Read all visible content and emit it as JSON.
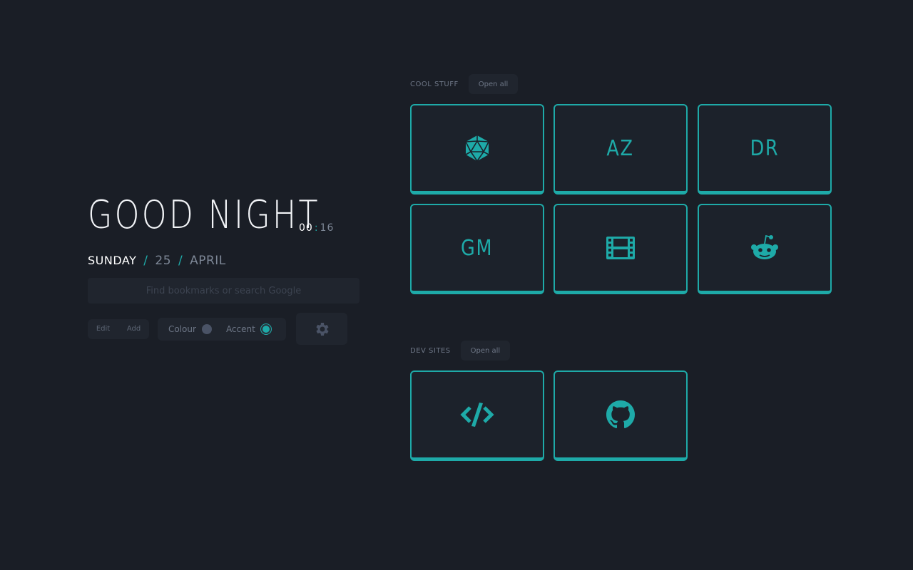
{
  "greeting": {
    "text": "GOOD NIGHT",
    "clock_hours": "00",
    "clock_separator": ":",
    "clock_minutes": "16"
  },
  "date": {
    "day": "SUNDAY",
    "slash1": "/",
    "number": "25",
    "slash2": "/",
    "month": "APRIL"
  },
  "search": {
    "placeholder": "Find bookmarks or search Google"
  },
  "controls": {
    "edit_label": "Edit",
    "add_label": "Add",
    "colour_label": "Colour",
    "accent_label": "Accent"
  },
  "groups": [
    {
      "title": "COOL STUFF",
      "open_all": "Open all",
      "cards": [
        {
          "icon": "d20-dice-icon"
        },
        {
          "label": "AZ"
        },
        {
          "label": "DR"
        },
        {
          "label": "GM"
        },
        {
          "icon": "film-icon"
        },
        {
          "icon": "reddit-icon"
        }
      ]
    },
    {
      "title": "DEV SITES",
      "open_all": "Open all",
      "cards": [
        {
          "icon": "code-icon"
        },
        {
          "icon": "github-icon"
        }
      ]
    }
  ],
  "colors": {
    "background": "#1a1e26",
    "accent": "#1eaaa8",
    "panel": "#20252e",
    "muted_text": "#6d7686"
  }
}
